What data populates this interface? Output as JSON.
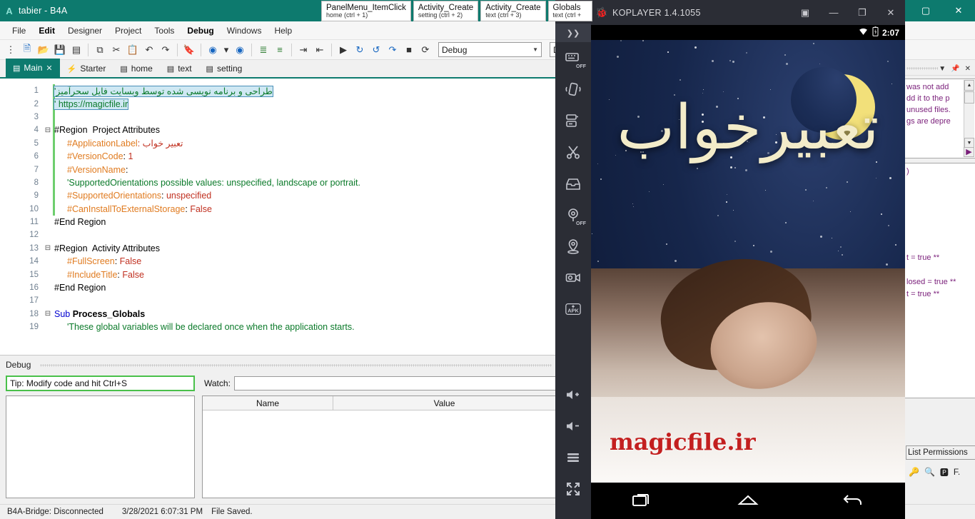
{
  "ide": {
    "window_title": "tabier - B4A",
    "logo_letter": "A",
    "window_buttons": [
      "—",
      "▢",
      "✕"
    ],
    "menu": [
      {
        "label": "File",
        "bold": false
      },
      {
        "label": "Edit",
        "bold": true
      },
      {
        "label": "Designer",
        "bold": false
      },
      {
        "label": "Project",
        "bold": false
      },
      {
        "label": "Tools",
        "bold": false
      },
      {
        "label": "Debug",
        "bold": true
      },
      {
        "label": "Windows",
        "bold": false
      },
      {
        "label": "Help",
        "bold": false
      }
    ],
    "jump_tabs": [
      {
        "title": "PanelMenu_ItemClick",
        "sub": "home  (ctrl + 1)"
      },
      {
        "title": "Activity_Create",
        "sub": "setting  (ctrl + 2)"
      },
      {
        "title": "Activity_Create",
        "sub": "text  (ctrl + 3)"
      },
      {
        "title": "Globals",
        "sub": "text  (ctrl +"
      }
    ],
    "toolbar": {
      "build_combo_value": "Debug",
      "config_combo_value": "Default"
    },
    "file_tabs": [
      {
        "label": "Main",
        "active": true,
        "closable": true
      },
      {
        "label": "Starter",
        "active": false,
        "closable": false
      },
      {
        "label": "home",
        "active": false,
        "closable": false
      },
      {
        "label": "text",
        "active": false,
        "closable": false
      },
      {
        "label": "setting",
        "active": false,
        "closable": false
      }
    ],
    "code_lines": [
      {
        "n": "1",
        "fold": "",
        "indent": 0,
        "selected": true,
        "parts": [
          {
            "t": "'طراحی و برنامه نویسی شده توسط وبسایت فایل سحرآمیز",
            "c": "k-green"
          }
        ]
      },
      {
        "n": "2",
        "fold": "",
        "indent": 0,
        "selected": true,
        "parts": [
          {
            "t": "' https://magicfile.ir",
            "c": "k-green"
          }
        ]
      },
      {
        "n": "3",
        "fold": "",
        "indent": 0,
        "selected": false,
        "parts": []
      },
      {
        "n": "4",
        "fold": "-",
        "indent": 0,
        "selected": false,
        "parts": [
          {
            "t": "#Region  Project Attributes",
            "c": "k-black"
          }
        ]
      },
      {
        "n": "5",
        "fold": "",
        "indent": 1,
        "selected": false,
        "parts": [
          {
            "t": "#ApplicationLabel",
            "c": "k-orange"
          },
          {
            "t": ": تعبیر خواب",
            "c": "k-red"
          }
        ]
      },
      {
        "n": "6",
        "fold": "",
        "indent": 1,
        "selected": false,
        "parts": [
          {
            "t": "#VersionCode",
            "c": "k-orange"
          },
          {
            "t": ": ",
            "c": "k-black"
          },
          {
            "t": "1",
            "c": "k-red"
          }
        ]
      },
      {
        "n": "7",
        "fold": "",
        "indent": 1,
        "selected": false,
        "parts": [
          {
            "t": "#VersionName",
            "c": "k-orange"
          },
          {
            "t": ":",
            "c": "k-black"
          }
        ]
      },
      {
        "n": "8",
        "fold": "",
        "indent": 1,
        "selected": false,
        "parts": [
          {
            "t": "'SupportedOrientations possible values: unspecified, landscape or portrait.",
            "c": "k-green"
          }
        ]
      },
      {
        "n": "9",
        "fold": "",
        "indent": 1,
        "selected": false,
        "parts": [
          {
            "t": "#SupportedOrientations",
            "c": "k-orange"
          },
          {
            "t": ": ",
            "c": "k-black"
          },
          {
            "t": "unspecified",
            "c": "k-red"
          }
        ]
      },
      {
        "n": "10",
        "fold": "",
        "indent": 1,
        "selected": false,
        "parts": [
          {
            "t": "#CanInstallToExternalStorage",
            "c": "k-orange"
          },
          {
            "t": ": ",
            "c": "k-black"
          },
          {
            "t": "False",
            "c": "k-red"
          }
        ]
      },
      {
        "n": "11",
        "fold": "",
        "indent": 0,
        "selected": false,
        "parts": [
          {
            "t": "#End Region",
            "c": "k-black"
          }
        ]
      },
      {
        "n": "12",
        "fold": "",
        "indent": 0,
        "selected": false,
        "parts": []
      },
      {
        "n": "13",
        "fold": "-",
        "indent": 0,
        "selected": false,
        "parts": [
          {
            "t": "#Region  Activity Attributes",
            "c": "k-black"
          }
        ]
      },
      {
        "n": "14",
        "fold": "",
        "indent": 1,
        "selected": false,
        "parts": [
          {
            "t": "#FullScreen",
            "c": "k-orange"
          },
          {
            "t": ": ",
            "c": "k-black"
          },
          {
            "t": "False",
            "c": "k-red"
          }
        ]
      },
      {
        "n": "15",
        "fold": "",
        "indent": 1,
        "selected": false,
        "parts": [
          {
            "t": "#IncludeTitle",
            "c": "k-orange"
          },
          {
            "t": ": ",
            "c": "k-black"
          },
          {
            "t": "False",
            "c": "k-red"
          }
        ]
      },
      {
        "n": "16",
        "fold": "",
        "indent": 0,
        "selected": false,
        "parts": [
          {
            "t": "#End Region",
            "c": "k-black"
          }
        ]
      },
      {
        "n": "17",
        "fold": "",
        "indent": 0,
        "selected": false,
        "parts": []
      },
      {
        "n": "18",
        "fold": "-",
        "indent": 0,
        "selected": false,
        "parts": [
          {
            "t": "Sub ",
            "c": "k-blue"
          },
          {
            "t": "Process_Globals",
            "c": "k-bold"
          }
        ]
      },
      {
        "n": "19",
        "fold": "",
        "indent": 1,
        "selected": false,
        "parts": [
          {
            "t": "'These global variables will be declared once when the application starts.",
            "c": "k-green"
          }
        ]
      }
    ],
    "debug": {
      "panel_title": "Debug",
      "tip_text": "Tip: Modify code and hit Ctrl+S",
      "watch_label": "Watch:",
      "watch_value": "",
      "grid_headers": [
        "Name",
        "Value"
      ],
      "grid_rows": []
    },
    "status": {
      "bridge": "B4A-Bridge: Disconnected",
      "timestamp": "3/28/2021 6:07:31 PM",
      "message": "File Saved."
    },
    "right_panel": {
      "log_lines_top": [
        "was not add",
        "dd it to the p",
        "unused files.",
        "gs are depre"
      ],
      "log_lines_bottom": [
        ")",
        "",
        "",
        "t = true **",
        "",
        "losed = true **",
        "t = true **"
      ],
      "button_label": "List Permissions",
      "icons": [
        "search-key-icon",
        "zoom-icon",
        "paste-format-icon",
        "find-icon"
      ]
    }
  },
  "emulator": {
    "window_title": "KOPLAYER 1.4.1055",
    "window_buttons": [
      "▣",
      "—",
      "❐",
      "✕"
    ],
    "status_bar": {
      "time": "2:07",
      "wifi": "wifi-icon",
      "battery": "battery-icon"
    },
    "sidebar_icons": [
      "collapse-icon",
      "keyboard-off-icon",
      "shake-icon",
      "battery-sim-icon",
      "scissors-icon",
      "share-icon",
      "gps-off-icon",
      "location-icon",
      "record-video-icon",
      "install-apk-icon",
      "volume-up-icon",
      "volume-down-icon",
      "menu-icon",
      "fullscreen-icon"
    ],
    "app": {
      "title_fa": "تعبیرخواب",
      "watermark": "magicfile.ir"
    },
    "nav_buttons": [
      "recents-icon",
      "home-icon",
      "back-icon"
    ]
  },
  "colors": {
    "ide_accent": "#0d7a6e",
    "emulator_chrome": "#2b2d35",
    "tip_border": "#49c04a",
    "selection": "#cfe8f3",
    "brand_red": "#c31f1f"
  }
}
